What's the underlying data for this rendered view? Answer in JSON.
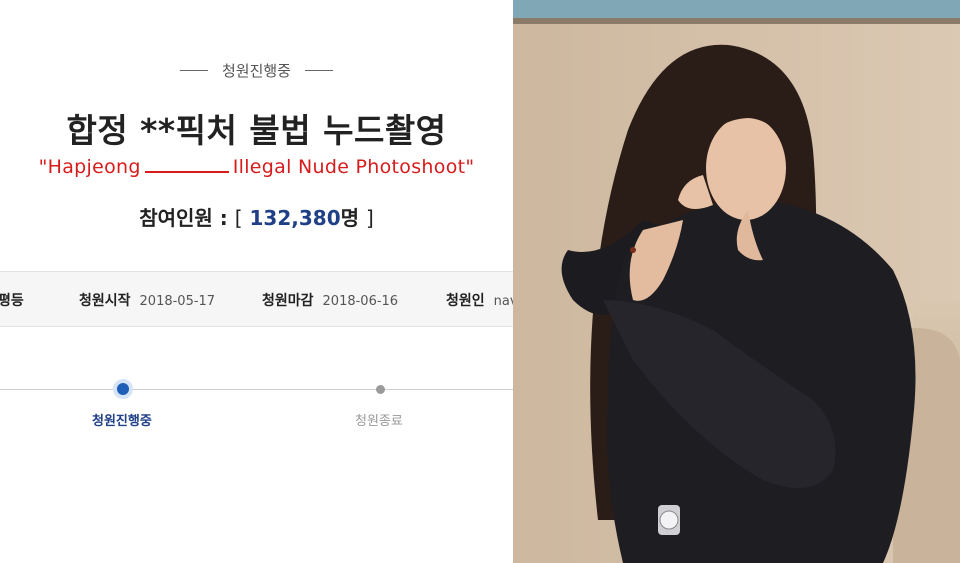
{
  "petition": {
    "status_label": "청원진행중",
    "title": "합정 **픽처 불법 누드촬영",
    "translation_start": "\"Hapjeong",
    "translation_end": "Illegal Nude Photoshoot\"",
    "participants_label": "참여인원 :",
    "participants_open": "[",
    "participants_count": "132,380",
    "participants_unit": "명",
    "participants_close": "]"
  },
  "info_bar": {
    "category_value": "평등",
    "start_label": "청원시작",
    "start_date": "2018-05-17",
    "end_label": "청원마감",
    "end_date": "2018-06-16",
    "petitioner_label": "청원인",
    "petitioner_value": "nav"
  },
  "timeline": {
    "step_active": "청원진행중",
    "step_inactive": "청원종료"
  },
  "photo": {
    "description_icon": "photo-person"
  },
  "colors": {
    "accent_red": "#d81b1b",
    "accent_blue": "#1f3f86"
  }
}
